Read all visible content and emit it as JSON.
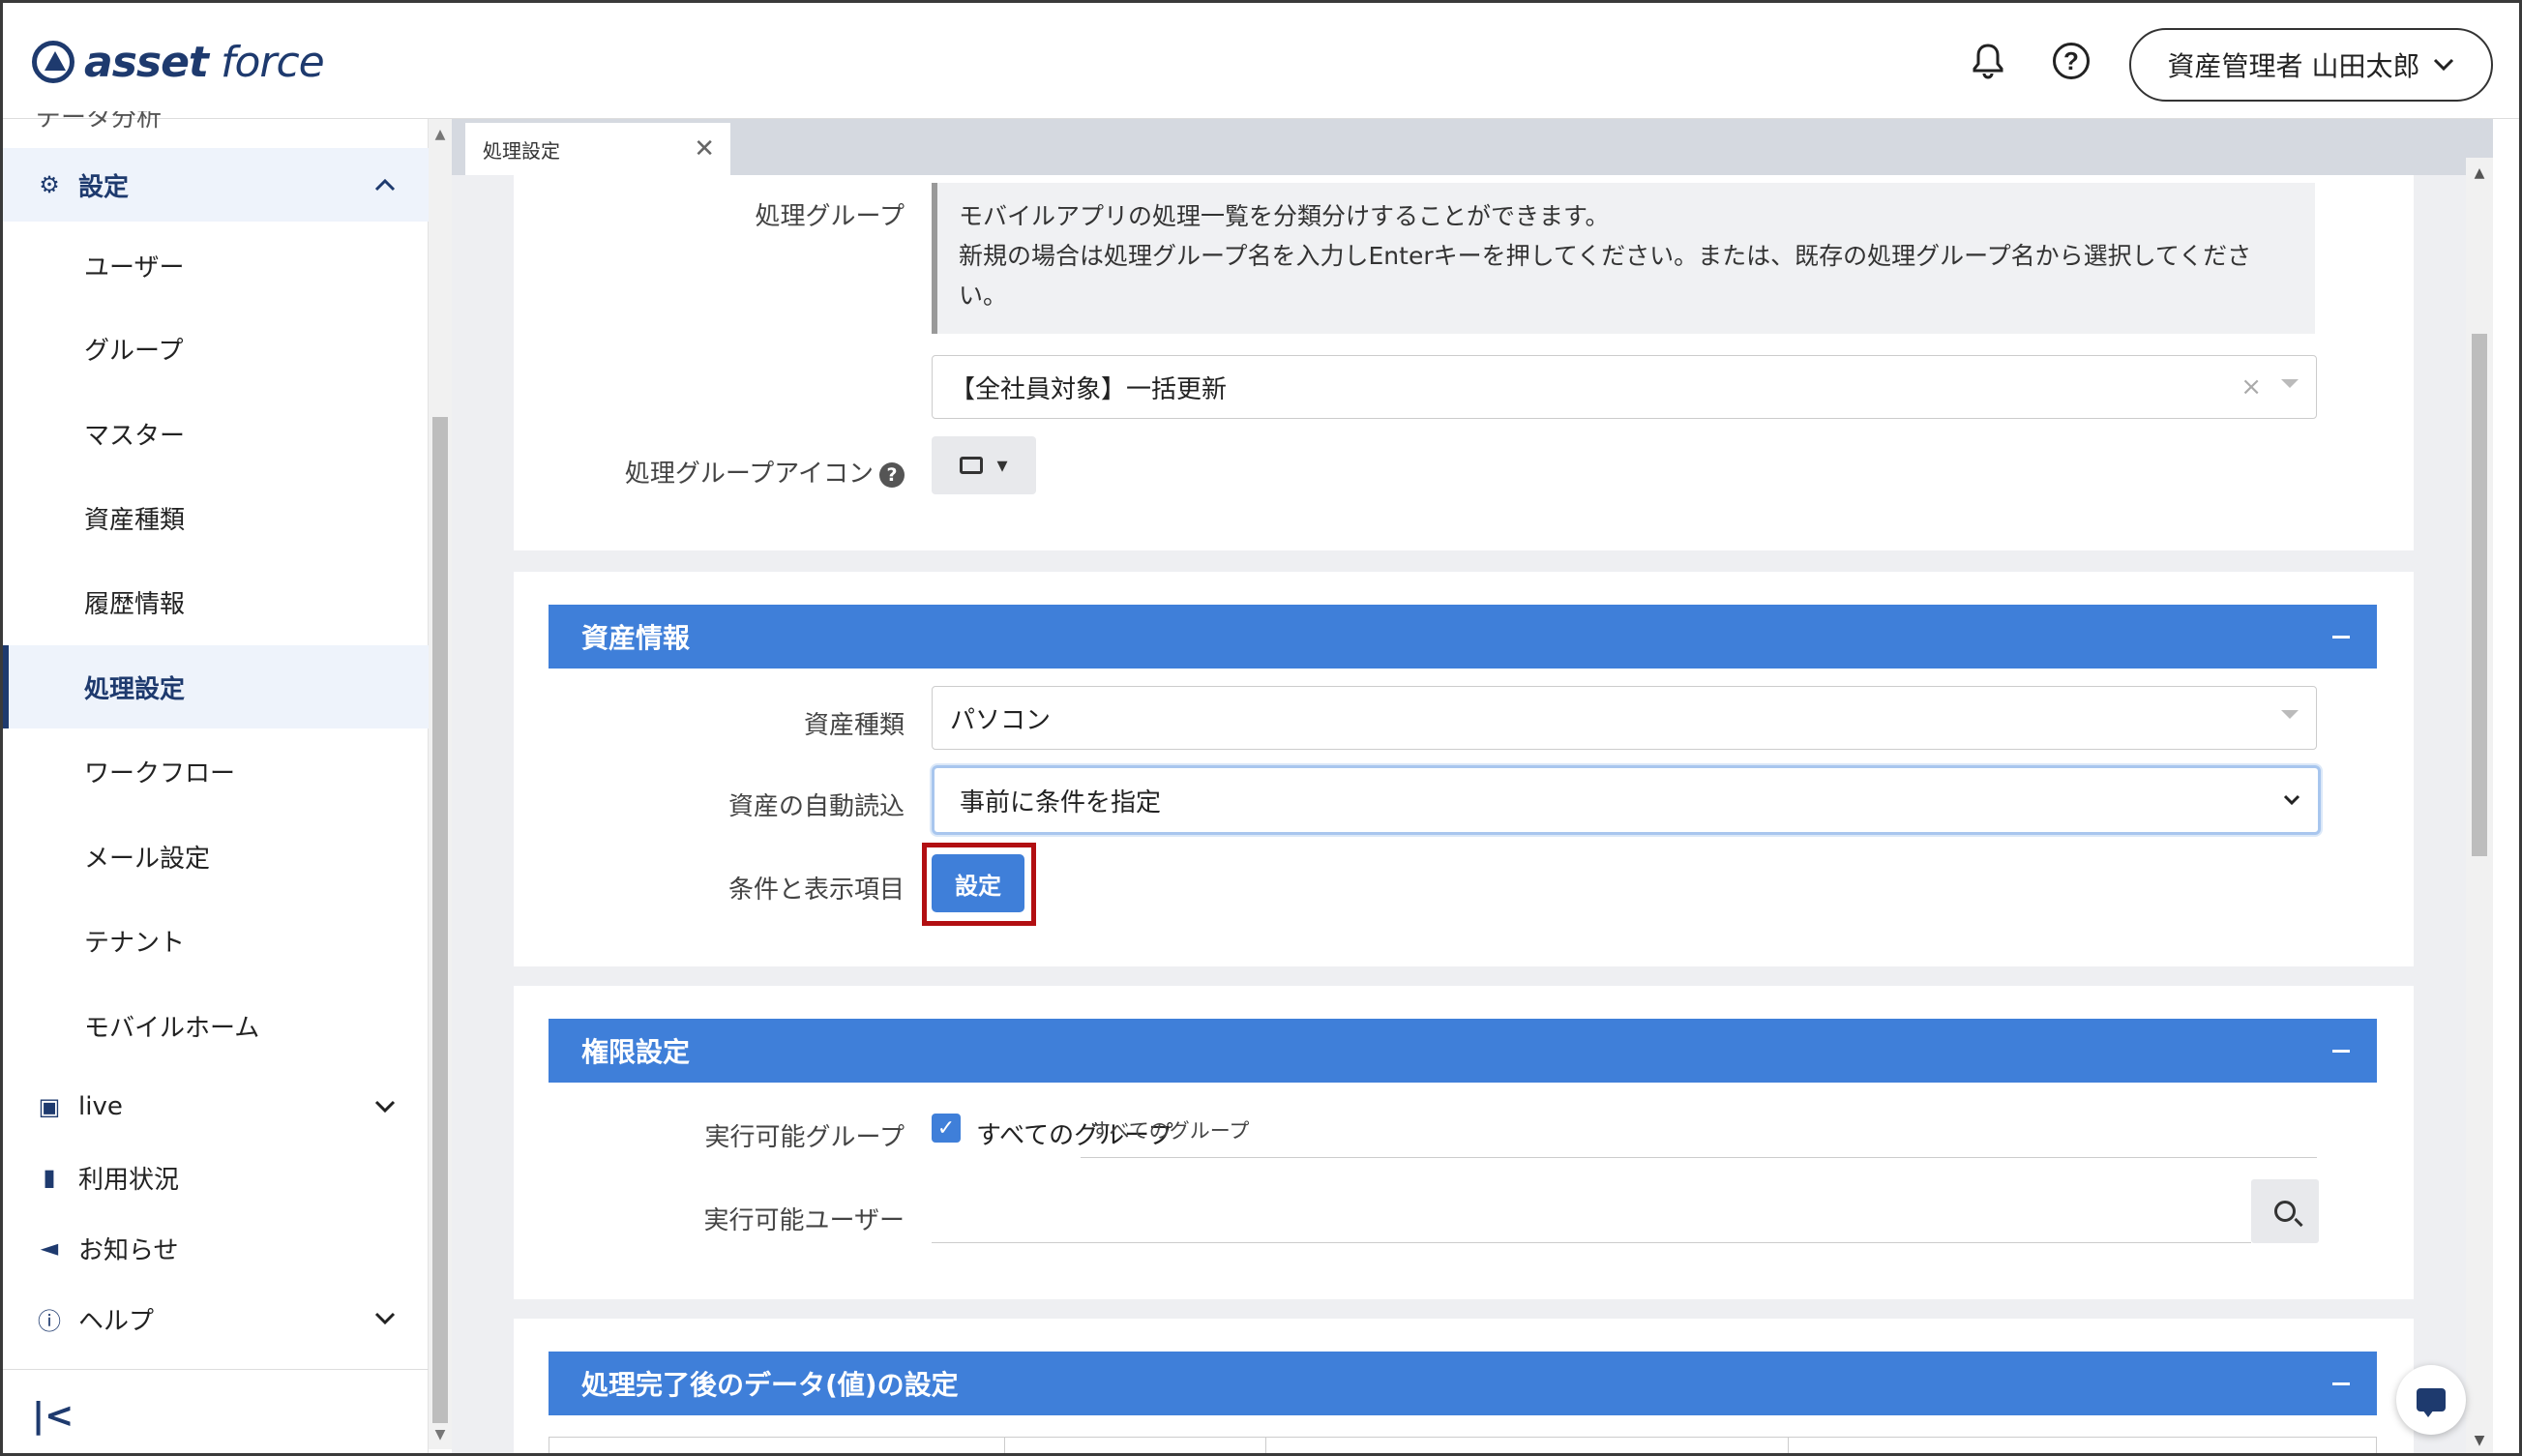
{
  "header": {
    "logo_left": "asset",
    "logo_right": "force",
    "user_menu": "資産管理者 山田太郎"
  },
  "sidebar": {
    "clipped_item": "データ分析",
    "parent": "設定",
    "sub_items": [
      "ユーザー",
      "グループ",
      "マスター",
      "資産種類",
      "履歴情報",
      "処理設定",
      "ワークフロー",
      "メール設定",
      "テナント",
      "モバイルホーム"
    ],
    "active_item": "処理設定",
    "top_items": [
      {
        "label": "live",
        "icon": "live-icon",
        "expandable": true
      },
      {
        "label": "利用状況",
        "icon": "bar-chart-icon",
        "expandable": false
      },
      {
        "label": "お知らせ",
        "icon": "megaphone-icon",
        "expandable": false
      },
      {
        "label": "ヘルプ",
        "icon": "help-icon",
        "expandable": true
      }
    ]
  },
  "tab": {
    "label": "処理設定"
  },
  "group_card": {
    "group_label": "処理グループ",
    "info_line1": "モバイルアプリの処理一覧を分類分けすることができます。",
    "info_line2": "新規の場合は処理グループ名を入力しEnterキーを押してください。または、既存の処理グループ名から選択してくださ",
    "info_line3": "い。",
    "group_value": "【全社員対象】一括更新",
    "icon_label": "処理グループアイコン"
  },
  "asset_section": {
    "title": "資産情報",
    "type_label": "資産種類",
    "type_value": "パソコン",
    "auto_label": "資産の自動読込",
    "auto_value": "事前に条件を指定",
    "cond_label": "条件と表示項目",
    "cond_button": "設定"
  },
  "permission_section": {
    "title": "権限設定",
    "group_label": "実行可能グループ",
    "all_groups_checkbox": "すべてのグループ",
    "all_groups_tag": "すべてのグループ",
    "user_label": "実行可能ユーザー"
  },
  "data_section": {
    "title": "処理完了後のデータ(値)の設定"
  },
  "colors": {
    "accent": "#3f7fd9",
    "brand": "#1e3a6e",
    "highlight": "#b20f12"
  }
}
